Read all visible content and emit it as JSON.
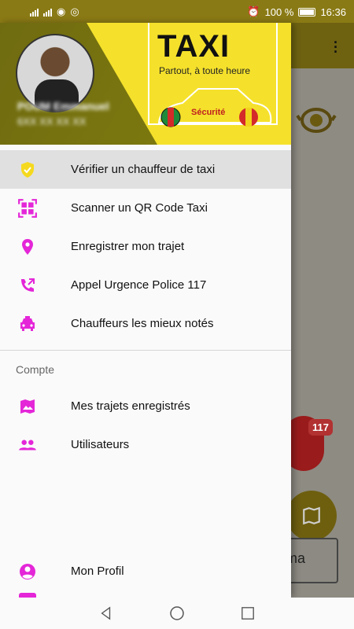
{
  "status_bar": {
    "network_left": "4G",
    "network_right": "3G",
    "alarm_icon": "alarm-icon",
    "battery": "100 %",
    "time": "16:36"
  },
  "drawer": {
    "header": {
      "logo_title": "TAXI",
      "logo_tagline": "Partout, à toute heure",
      "car_label": "Sécurité",
      "user_name": "POUM Emmanuel",
      "user_phone": "6XX XX XX XX"
    },
    "items": [
      {
        "label": "Vérifier un chauffeur de taxi",
        "icon": "shield-check-icon",
        "selected": true
      },
      {
        "label": "Scanner un QR Code Taxi",
        "icon": "qr-scan-icon"
      },
      {
        "label": "Enregistrer mon trajet",
        "icon": "location-pin-icon"
      },
      {
        "label": "Appel Urgence Police 117",
        "icon": "phone-forward-icon"
      },
      {
        "label": "Chauffeurs les mieux notés",
        "icon": "taxi-icon"
      }
    ],
    "section_title": "Compte",
    "account_items": [
      {
        "label": "Mes trajets enregistrés",
        "icon": "map-icon"
      },
      {
        "label": "Utilisateurs",
        "icon": "group-icon"
      }
    ],
    "profile_item": {
      "label": "Mon Profil",
      "icon": "account-circle-icon"
    }
  },
  "background": {
    "badge": "117",
    "button_text": "ma"
  },
  "colors": {
    "accent": "#e426d8",
    "selected_icon": "#f5d91f",
    "header_yellow": "#f5e12b"
  }
}
